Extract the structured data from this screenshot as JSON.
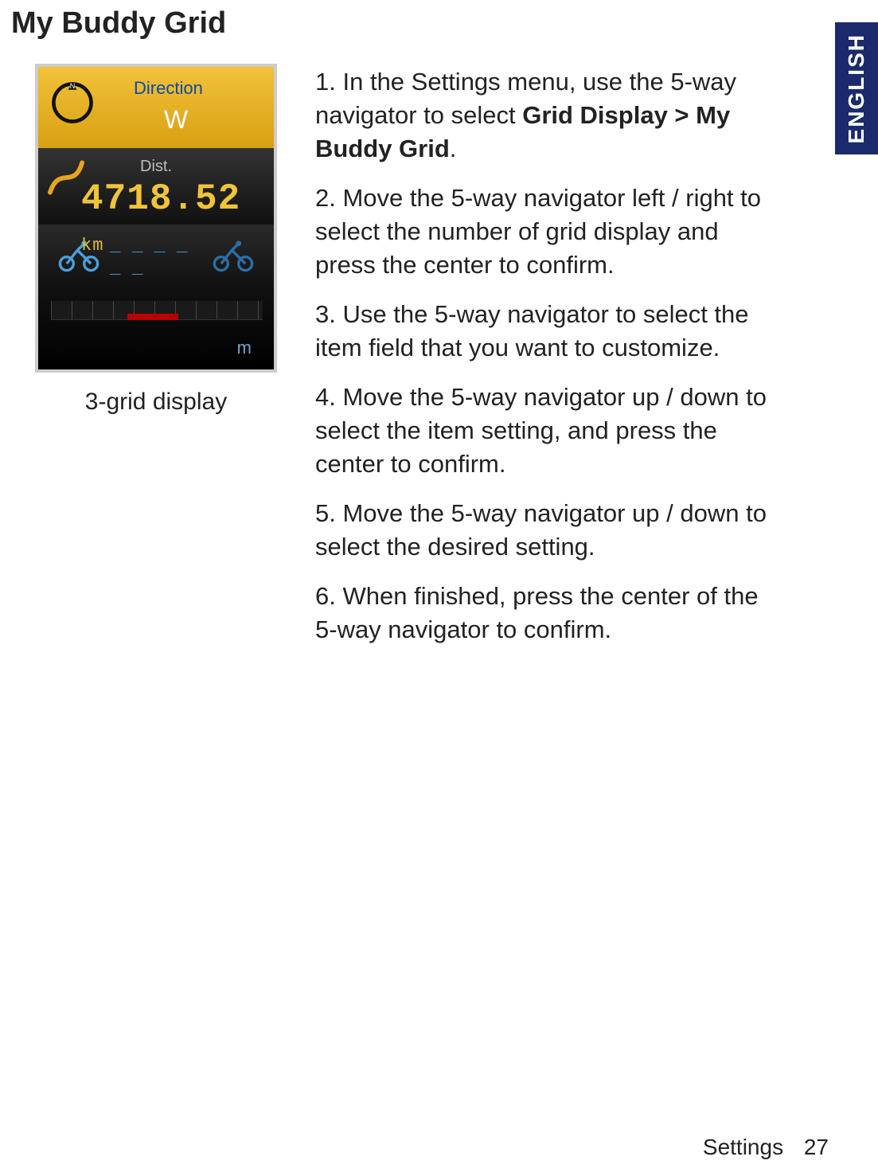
{
  "page_title": "My Buddy Grid",
  "language_tab": "ENGLISH",
  "device": {
    "direction": {
      "label": "Direction",
      "value": "W"
    },
    "distance": {
      "label": "Dist.",
      "value": "4718.52",
      "unit": "km"
    },
    "riders": {
      "dashes": "_ _ _ _ _ _"
    },
    "altitude": {
      "unit": "m"
    }
  },
  "caption": "3-grid display",
  "steps": [
    {
      "n": "1.",
      "pre": "In the Settings menu, use the 5-way navigator to select ",
      "bold": "Grid Display > My Buddy Grid",
      "post": "."
    },
    {
      "n": "2.",
      "text": "Move the 5-way navigator left / right to select the number of grid display and press the center to confirm."
    },
    {
      "n": "3.",
      "text": "Use the 5-way navigator to select the item field that you want to customize."
    },
    {
      "n": "4.",
      "text": "Move the 5-way navigator up / down to select the item setting, and press the center to confirm."
    },
    {
      "n": "5.",
      "text": "Move the 5-way navigator up / down to select the desired setting."
    },
    {
      "n": "6.",
      "text": "When finished, press the center of the 5-way navigator to confirm."
    }
  ],
  "footer": {
    "section": "Settings",
    "page": "27"
  }
}
